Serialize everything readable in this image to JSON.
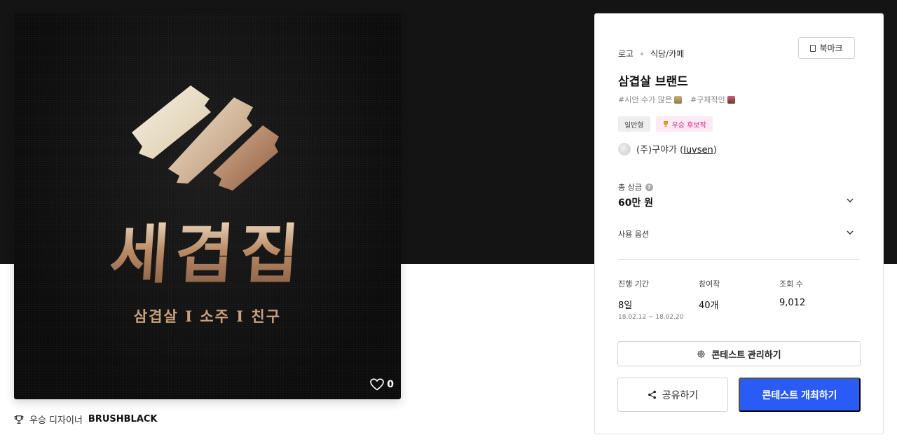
{
  "hero_image": {
    "logo_name": "세겹집",
    "tagline": "삼겹살 I 소주 I 친구",
    "likes": "0",
    "colors": {
      "background": "#0f0f0f",
      "gold_light": "#f1e8d4",
      "gold": "#c8a07c",
      "bronze": "#9a6b4c"
    }
  },
  "designer": {
    "prefix": "우승 디자이너",
    "name": "BRUSHBLACK",
    "icon": "trophy-icon"
  },
  "contest": {
    "breadcrumb": [
      "로고",
      "식당/카페"
    ],
    "bookmark_label": "북마크",
    "title": "삼겹살 브랜드",
    "tags": [
      {
        "label": "#시안 수가 많은",
        "icon": "crowd-emoji"
      },
      {
        "label": "#구체적인",
        "icon": "detail-emoji"
      }
    ],
    "badges": [
      {
        "label": "일반형"
      },
      {
        "label": "우승 후보작",
        "icon": "trophy-icon"
      }
    ],
    "owner": {
      "company": "(주)구야가",
      "handle": "luvsen"
    },
    "prize": {
      "label": "총 상금",
      "value": "60만 원"
    },
    "usage_label": "사용 옵션",
    "stats": [
      {
        "label": "진행 기간",
        "value": "8일",
        "sub": "18.02.12 ~ 18.02.20"
      },
      {
        "label": "참여작",
        "value": "40개"
      },
      {
        "label": "조회 수",
        "value": "9,012"
      }
    ],
    "manage_label": "콘테스트 관리하기",
    "share_label": "공유하기",
    "host_label": "콘테스트 개최하기"
  },
  "colors": {
    "accent": "#2b5bf5",
    "candidate_badge_bg": "#fdeaf4",
    "candidate_badge_text": "#d0267e"
  }
}
